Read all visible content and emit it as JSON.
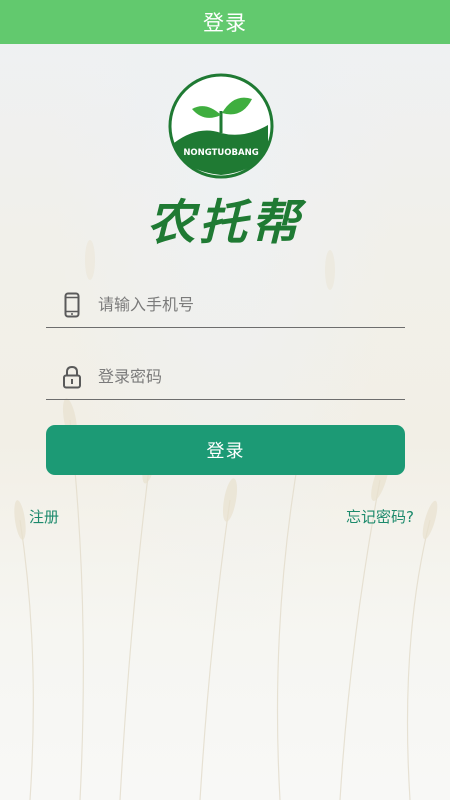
{
  "header": {
    "title": "登录"
  },
  "logo": {
    "badge_text": "NONGTUOBANG",
    "icon": "sprout-logo-icon"
  },
  "brand": {
    "name": "农托帮"
  },
  "form": {
    "phone": {
      "placeholder": "请输入手机号",
      "value": "",
      "icon": "phone-icon"
    },
    "password": {
      "placeholder": "登录密码",
      "value": "",
      "icon": "lock-icon"
    },
    "login_label": "登录"
  },
  "links": {
    "register": "注册",
    "forgot": "忘记密码?"
  },
  "colors": {
    "topbar": "#62c96e",
    "button": "#1c9a75",
    "brand_green": "#1f7a33",
    "link": "#1c8a6c"
  }
}
